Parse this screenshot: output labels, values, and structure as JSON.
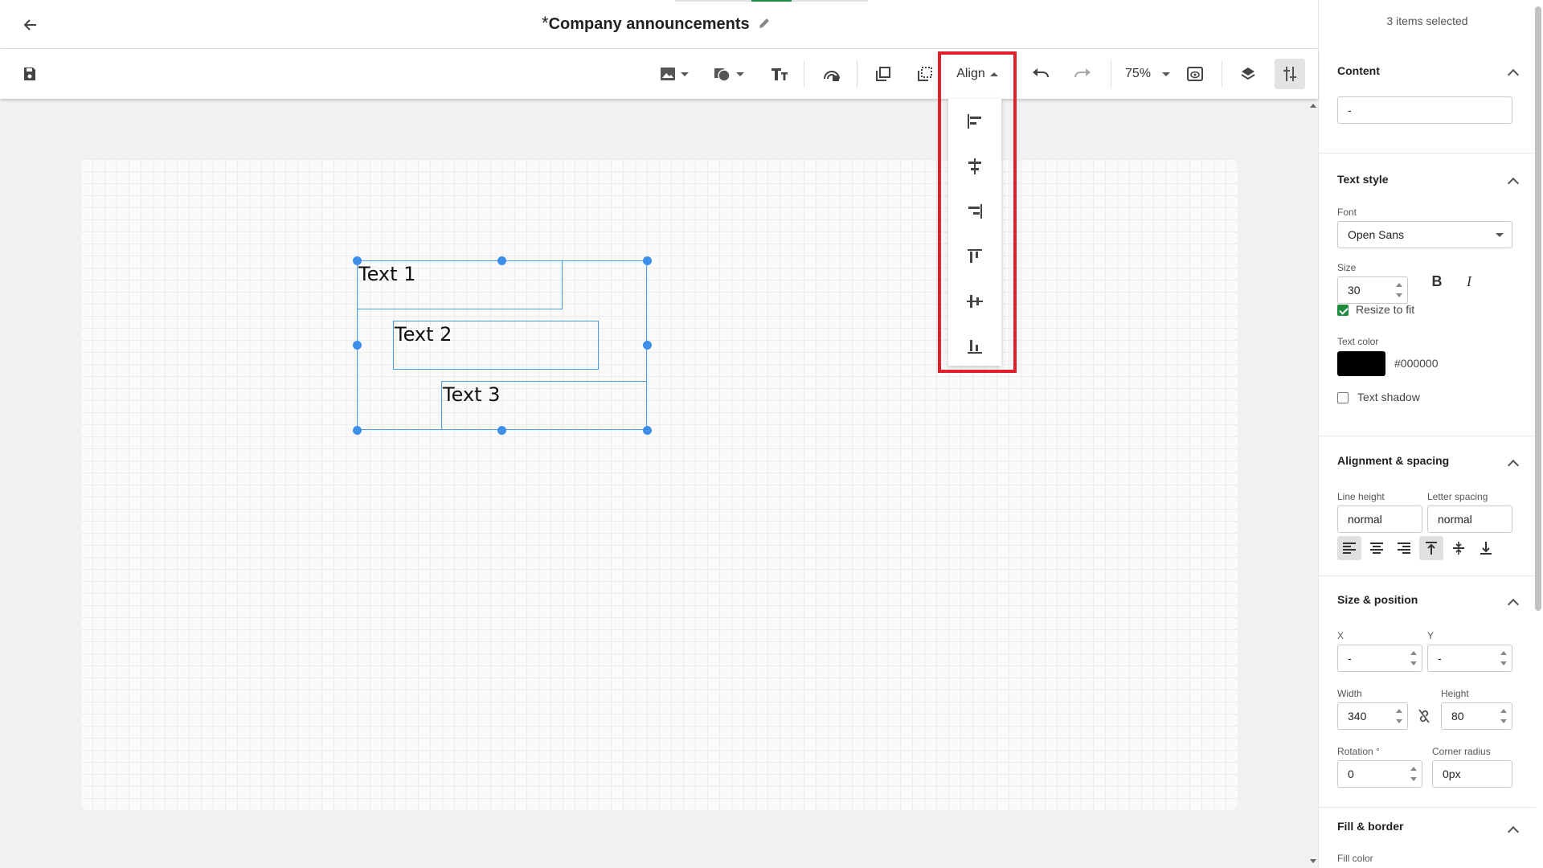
{
  "header": {
    "modified_mark": "*",
    "title": "Company announcements"
  },
  "toolbar": {
    "align_label": "Align",
    "zoom_label": "75%"
  },
  "canvas": {
    "text_boxes": [
      {
        "text": "Text 1"
      },
      {
        "text": "Text 2"
      },
      {
        "text": "Text 3"
      }
    ]
  },
  "panel": {
    "selected_count": "3 items selected",
    "content": {
      "title": "Content",
      "value": "-"
    },
    "text_style": {
      "title": "Text style",
      "font_label": "Font",
      "font_value": "Open Sans",
      "size_label": "Size",
      "size_value": "30",
      "bold_label": "B",
      "italic_label": "I",
      "resize_label": "Resize to fit",
      "resize_checked": true,
      "color_label": "Text color",
      "color_value": "#000000",
      "shadow_label": "Text shadow",
      "shadow_checked": false
    },
    "alignment": {
      "title": "Alignment & spacing",
      "line_height_label": "Line height",
      "line_height_value": "normal",
      "letter_spacing_label": "Letter spacing",
      "letter_spacing_value": "normal"
    },
    "size_position": {
      "title": "Size & position",
      "x_label": "X",
      "x_value": "-",
      "y_label": "Y",
      "y_value": "-",
      "width_label": "Width",
      "width_value": "340",
      "height_label": "Height",
      "height_value": "80",
      "rotation_label": "Rotation °",
      "rotation_value": "0",
      "corner_label": "Corner radius",
      "corner_value": "0px"
    },
    "fill_border": {
      "title": "Fill & border",
      "fill_color_label": "Fill color"
    }
  },
  "colors": {
    "accent": "#1e8e3e",
    "selection": "#4a9eea",
    "highlight": "#e0202a"
  }
}
